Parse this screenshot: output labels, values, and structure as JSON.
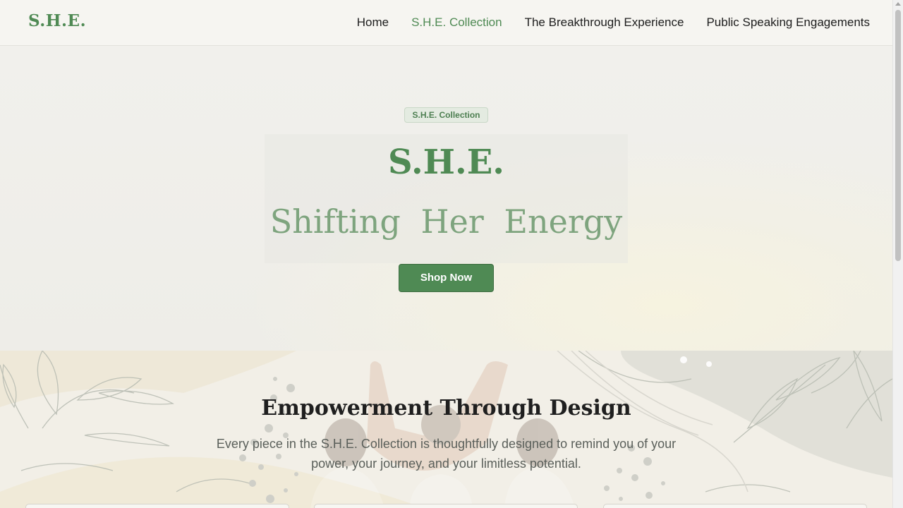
{
  "brand": "S.H.E.",
  "nav": {
    "items": [
      {
        "label": "Home",
        "active": false
      },
      {
        "label": "S.H.E. Collection",
        "active": true
      },
      {
        "label": "The Breakthrough Experience",
        "active": false
      },
      {
        "label": "Public Speaking Engagements",
        "active": false
      }
    ]
  },
  "hero": {
    "badge": "S.H.E. Collection",
    "title": "S.H.E.",
    "subtitle": "Shifting Her Energy",
    "button": "Shop Now"
  },
  "empowerment": {
    "title": "Empowerment Through Design",
    "text": "Every piece in the S.H.E. Collection is thoughtfully designed to remind you of your power, your journey, and your limitless potential."
  },
  "colors": {
    "accent": "#4f8a54",
    "accent_light": "#7ea47e",
    "background": "#f4f3ef"
  }
}
